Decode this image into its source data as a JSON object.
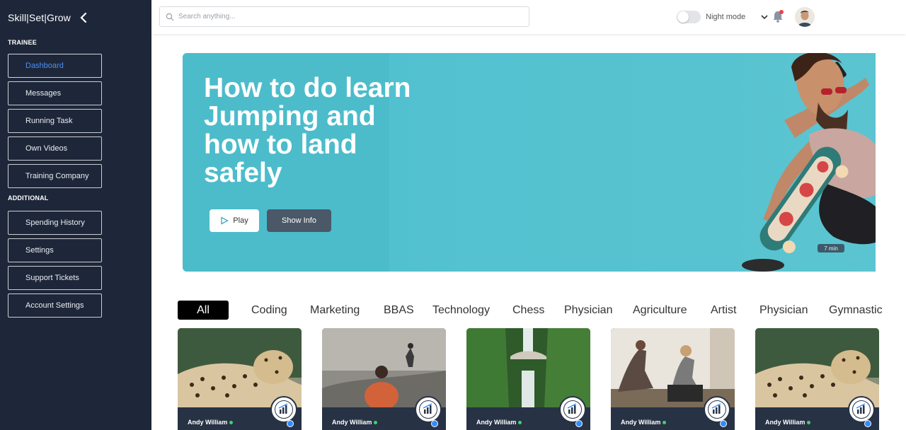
{
  "sidebar": {
    "brand": "Skill|Set|Grow",
    "section_trainee": "TRAINEE",
    "section_additional": "ADDITIONAL",
    "trainee_items": [
      {
        "label": "Dashboard",
        "active": true
      },
      {
        "label": "Messages"
      },
      {
        "label": "Running Task"
      },
      {
        "label": "Own Videos"
      },
      {
        "label": "Training Company"
      }
    ],
    "additional_items": [
      {
        "label": "Spending History"
      },
      {
        "label": "Settings"
      },
      {
        "label": "Support Tickets"
      },
      {
        "label": "Account Settings"
      }
    ]
  },
  "topbar": {
    "search_placeholder": "Search anything...",
    "night_mode_label": "Night mode",
    "night_mode_on": false
  },
  "hero": {
    "title": "How to do learn Jumping and how to land safely",
    "play_label": "Play",
    "info_label": "Show Info",
    "duration": "7 min"
  },
  "categories": [
    "All",
    "Coding",
    "Marketing",
    "BBAS",
    "Technology",
    "Chess",
    "Physician",
    "Agriculture",
    "Artist",
    "Physician",
    "Gymnastic"
  ],
  "cards": [
    {
      "author": "Andy William",
      "thumb": "leopard"
    },
    {
      "author": "Andy William",
      "thumb": "runner"
    },
    {
      "author": "Andy William",
      "thumb": "waterfall"
    },
    {
      "author": "Andy William",
      "thumb": "yoga"
    },
    {
      "author": "Andy William",
      "thumb": "leopard"
    }
  ],
  "colors": {
    "sidebar_bg": "#1e2739",
    "active_nav": "#4d8ef2",
    "hero_bg": "#52c1cf",
    "online": "#3fd26b",
    "verify": "#2d8cff"
  }
}
